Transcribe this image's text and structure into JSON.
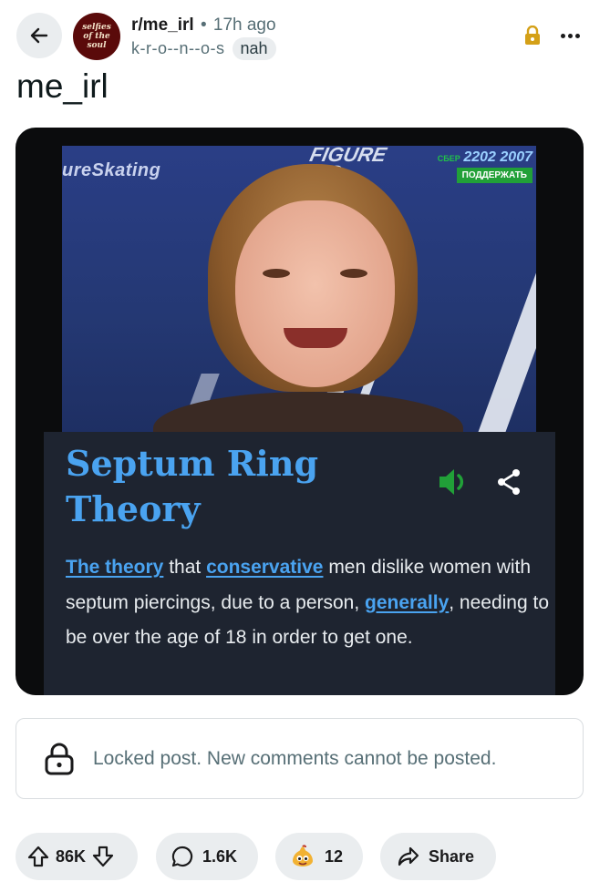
{
  "header": {
    "back_icon": "arrow-left-icon",
    "avatar_text": "selfies of the soul",
    "subreddit": "r/me_irl",
    "separator": "•",
    "time_ago": "17h ago",
    "username": "k-r-o--n--o-s",
    "flair": "nah",
    "lock_icon": "lock-icon",
    "more_icon": "more-horizontal-icon"
  },
  "post": {
    "title": "me_irl"
  },
  "media": {
    "watermark_left": "ureSkating",
    "watermark_center": "FIGURE\nING",
    "watermark_sber": "СБЕР",
    "watermark_number": "2202 2007",
    "watermark_support": "ПОДДЕРЖАТЬ",
    "definition_title": "Septum Ring Theory",
    "sound_icon": "speaker-icon",
    "share_icon": "share-nodes-icon",
    "definition": {
      "link1": "The theory",
      "text1": " that ",
      "link2": "conservative",
      "text2": " men dislike women with septum piercings, due to a person, ",
      "link3": "generally",
      "text3": ", needing to be over the age of 18 in order to get one."
    }
  },
  "locked_notice": {
    "icon": "lock-icon",
    "text": "Locked post. New comments cannot be posted."
  },
  "actions": {
    "upvote_icon": "upvote-arrow-icon",
    "score": "86K",
    "downvote_icon": "downvote-arrow-icon",
    "comment_icon": "comment-bubble-icon",
    "comments": "1.6K",
    "award_icon": "award-emoji-icon",
    "awards": "12",
    "share_icon": "share-arrow-icon",
    "share_label": "Share"
  },
  "colors": {
    "lock_gold": "#d4a017",
    "link_blue": "#4aa3f0",
    "card_bg": "#1e2430",
    "pill_bg": "#eaedef",
    "sound_green": "#21a038"
  }
}
